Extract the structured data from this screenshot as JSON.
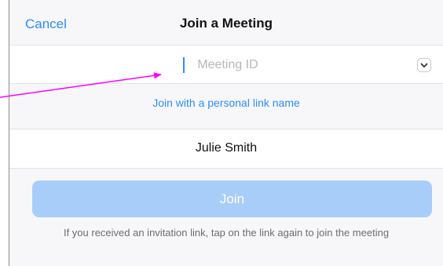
{
  "nav": {
    "cancel_label": "Cancel",
    "title": "Join a Meeting"
  },
  "meeting_id": {
    "value": "",
    "placeholder": "Meeting ID"
  },
  "personal_link": {
    "label": "Join with a personal link name"
  },
  "name_field": {
    "value": "Julie Smith"
  },
  "join_button": {
    "label": "Join"
  },
  "hint": {
    "text": "If you received an invitation link, tap on the link again to join the meeting"
  },
  "colors": {
    "accent": "#2d8cff",
    "join_disabled": "#a8cdf9",
    "annotation_arrow": "#ff00ff"
  },
  "icons": {
    "dropdown": "chevron-down-icon"
  }
}
